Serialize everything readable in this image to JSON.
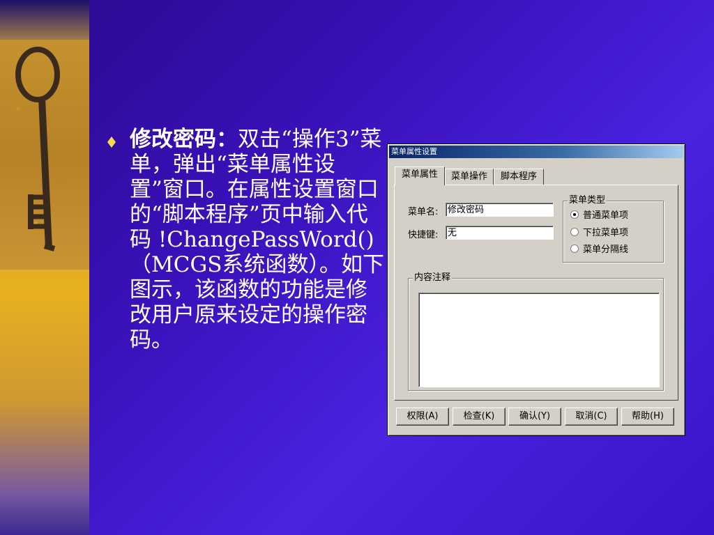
{
  "slide": {
    "heading": "修改密码：",
    "body_1": "双击“操作3”菜单，弹出“菜单属性设置”窗口。在属性设置窗口的“脚本程序”页中输入代码 !ChangePassWord()（MCGS系统函数）。如下图示，该函数的功能是修改用户原来设定的操作密码。"
  },
  "dialog": {
    "title": "菜单属性设置",
    "tabs": [
      {
        "label": "菜单属性",
        "active": true
      },
      {
        "label": "菜单操作",
        "active": false
      },
      {
        "label": "脚本程序",
        "active": false
      }
    ],
    "fields": {
      "menu_name_label": "菜单名:",
      "menu_name_value": "修改密码",
      "shortcut_label": "快捷键:",
      "shortcut_value": "无"
    },
    "menu_type": {
      "title": "菜单类型",
      "options": [
        {
          "label": "普通菜单项",
          "selected": true
        },
        {
          "label": "下拉菜单项",
          "selected": false
        },
        {
          "label": "菜单分隔线",
          "selected": false
        }
      ]
    },
    "content_note": {
      "title": "内容注释",
      "value": ""
    },
    "buttons": {
      "permission": "权限(A)",
      "check": "检查(K)",
      "confirm": "确认(Y)",
      "cancel": "取消(C)",
      "help": "帮助(H)"
    }
  },
  "colors": {
    "background": "#3a10b8",
    "dialog_face": "#d4d0c8",
    "titlebar": "#0a246a",
    "text": "#ffffff"
  },
  "icons": [
    "key-image",
    "diamond-bullet-icon",
    "scroll-up-icon",
    "scroll-down-icon"
  ]
}
